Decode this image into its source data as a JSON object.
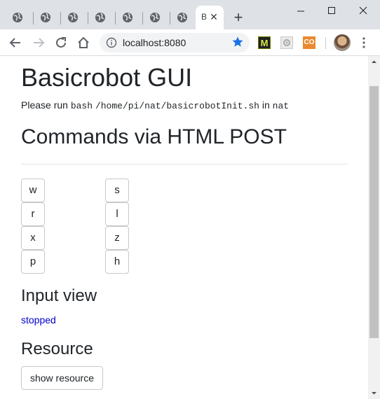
{
  "browser": {
    "active_tab_title": "B",
    "new_tab_label": "+",
    "url": "localhost:8080",
    "extensions": {
      "m_label": "M",
      "co_label": "CO"
    }
  },
  "page": {
    "title": "Basicrobot GUI",
    "run_prefix": "Please run",
    "run_cmd": "bash",
    "run_path": "/home/pi/nat/basicrobotInit.sh",
    "run_in": "in",
    "run_dir": "nat",
    "commands_heading": "Commands via HTML POST",
    "commands": {
      "w": "w",
      "r": "r",
      "x": "x",
      "p": "p",
      "s": "s",
      "l": "l",
      "z": "z",
      "h": "h"
    },
    "input_view_heading": "Input view",
    "input_status": "stopped",
    "resource_heading": "Resource",
    "show_resource_label": "show resource"
  },
  "colors": {
    "status_text": "#0000cc",
    "tabstrip_bg": "#dee1e6",
    "star": "#1a73e8"
  }
}
